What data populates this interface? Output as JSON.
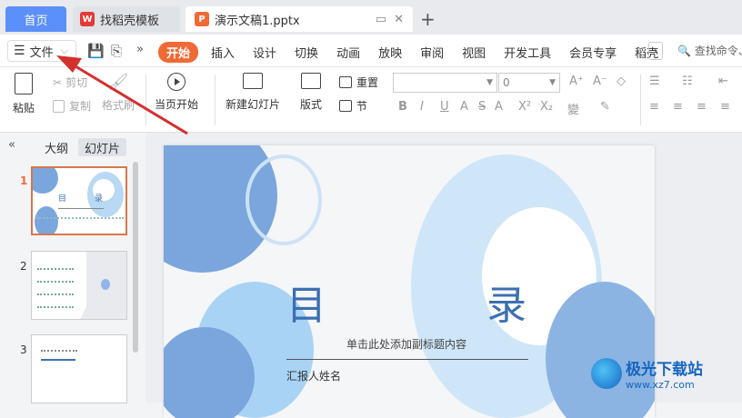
{
  "tabs": {
    "home": "首页",
    "template": "找稻壳模板",
    "document": "演示文稿1.pptx",
    "template_icon": "W",
    "document_icon": "P"
  },
  "menu": {
    "file": "文件",
    "items": [
      "开始",
      "插入",
      "设计",
      "切换",
      "动画",
      "放映",
      "审阅",
      "视图",
      "开发工具",
      "会员专享",
      "稻壳"
    ],
    "search": "查找命令、"
  },
  "ribbon": {
    "paste": "粘贴",
    "cut": "剪切",
    "copy": "复制",
    "format_painter": "格式刷",
    "play_from_current": "当页开始",
    "new_slide": "新建幻灯片",
    "layout": "版式",
    "section": "节",
    "reset": "重置",
    "font_size": "0"
  },
  "panel": {
    "outline_tab": "大纲",
    "slides_tab": "幻灯片",
    "thumbs": [
      {
        "num": "1",
        "title_left": "目",
        "title_right": "录"
      },
      {
        "num": "2"
      },
      {
        "num": "3"
      }
    ]
  },
  "slide": {
    "title_left": "目",
    "title_right": "录",
    "subtitle": "单击此处添加副标题内容",
    "reporter": "汇报人姓名"
  },
  "watermark": {
    "name": "极光下载站",
    "url": "www.xz7.com"
  },
  "colors": {
    "accent_orange": "#f06a35",
    "home_tab": "#5b8ff9",
    "title_blue": "#3b6fb1",
    "annotation_red": "#d32f2f"
  }
}
